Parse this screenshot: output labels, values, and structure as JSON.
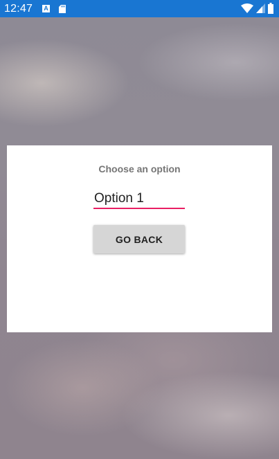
{
  "status_bar": {
    "time": "12:47",
    "app_icon_letter": "A",
    "background_color": "#1976d2"
  },
  "dialog": {
    "title": "Choose an option",
    "select_value": "Option 1",
    "back_button_label": "GO BACK",
    "accent_color": "#e91e63"
  }
}
